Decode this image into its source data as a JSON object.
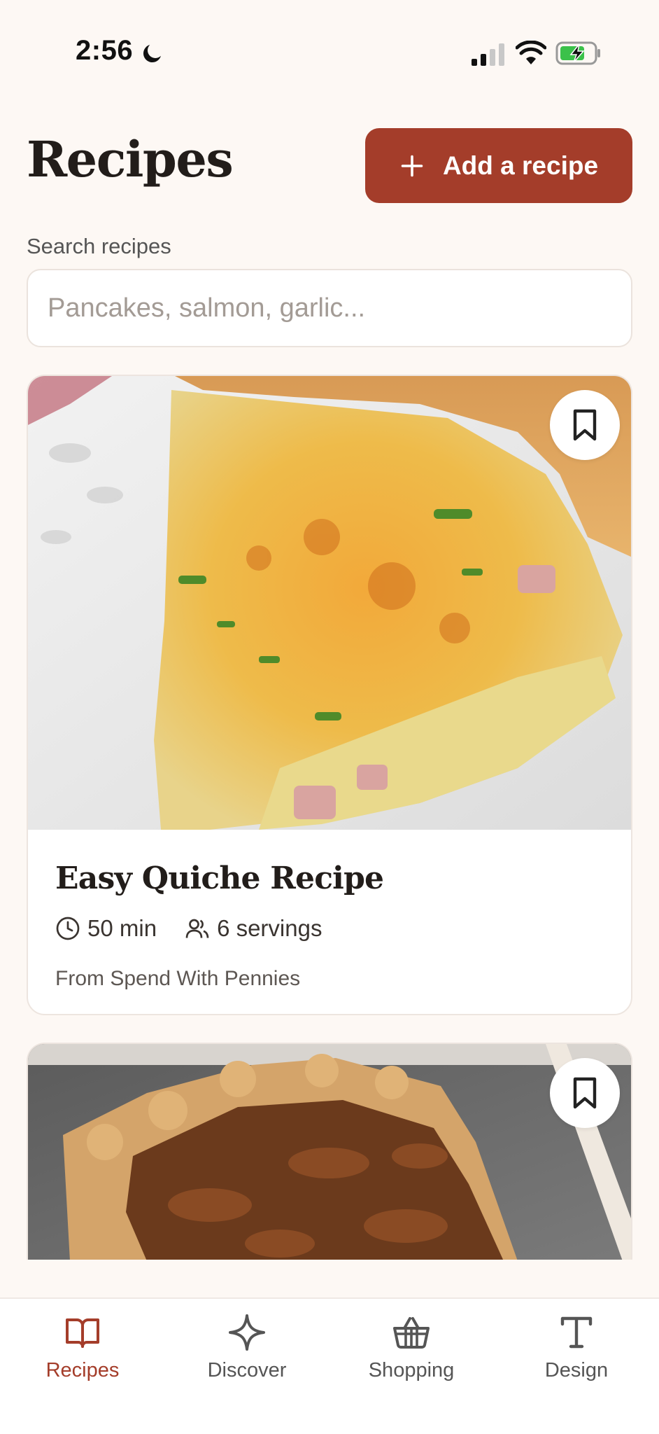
{
  "status_bar": {
    "time": "2:56"
  },
  "header": {
    "title": "Recipes",
    "add_button_label": "Add a recipe"
  },
  "search": {
    "label": "Search recipes",
    "placeholder": "Pancakes, salmon, garlic..."
  },
  "recipes": [
    {
      "title": "Easy Quiche Recipe",
      "time": "50 min",
      "servings": "6 servings",
      "source": "From Spend With Pennies"
    }
  ],
  "tabs": [
    {
      "label": "Recipes",
      "icon": "book-icon",
      "active": true
    },
    {
      "label": "Discover",
      "icon": "sparkle-icon",
      "active": false
    },
    {
      "label": "Shopping",
      "icon": "basket-icon",
      "active": false
    },
    {
      "label": "Design",
      "icon": "type-icon",
      "active": false
    }
  ],
  "colors": {
    "accent": "#a43d2a",
    "background": "#fdf8f4",
    "card": "#ffffff",
    "text": "#221d1a"
  }
}
